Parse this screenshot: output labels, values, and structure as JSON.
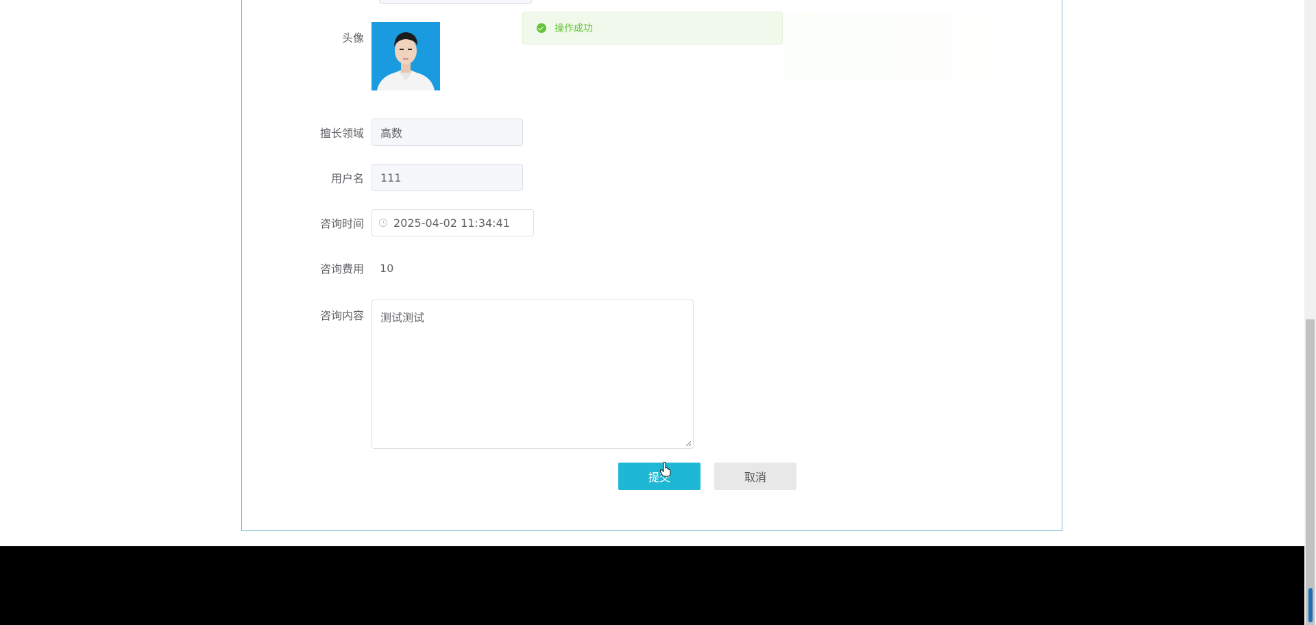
{
  "form": {
    "avatar": {
      "label": "头像"
    },
    "specialty": {
      "label": "擅长领域",
      "value": "高数"
    },
    "username": {
      "label": "用户名",
      "value": "111"
    },
    "consult_time": {
      "label": "咨询时间",
      "value": "2025-04-02 11:34:41"
    },
    "consult_fee": {
      "label": "咨询费用",
      "value": "10"
    },
    "consult_content": {
      "label": "咨询内容",
      "value": "测试测试"
    }
  },
  "actions": {
    "submit_label": "提交",
    "cancel_label": "取消"
  },
  "toast": {
    "message": "操作成功"
  },
  "colors": {
    "accent": "#1fb8d4",
    "success": "#67c23a",
    "card_border": "#6fb6c8"
  }
}
